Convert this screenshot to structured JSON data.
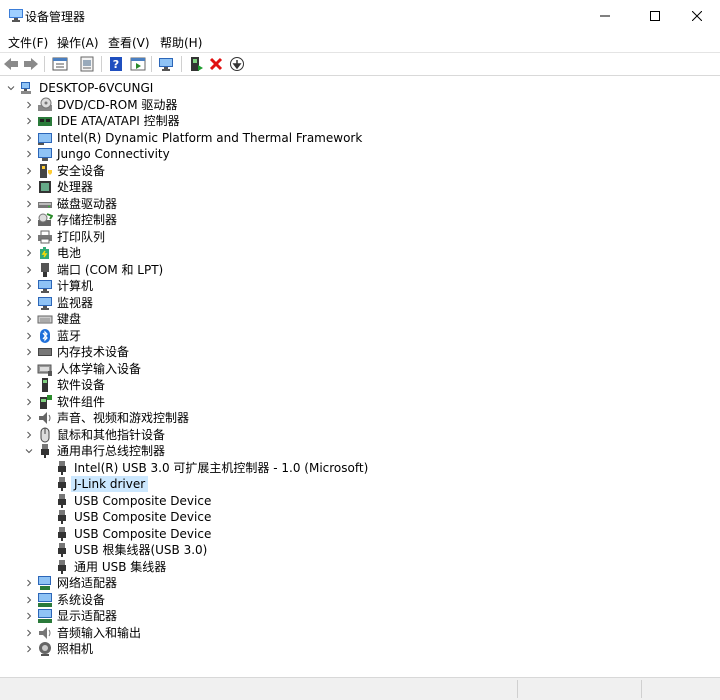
{
  "window": {
    "title": "设备管理器"
  },
  "menu": [
    "文件(F)",
    "操作(A)",
    "查看(V)",
    "帮助(H)"
  ],
  "toolbar": [
    "back-arrow-icon",
    "forward-arrow-icon",
    "properties-icon",
    "show-hidden-icon",
    "help-icon",
    "run-icon",
    "monitor-icon",
    "update-driver-icon",
    "uninstall-icon",
    "disable-icon"
  ],
  "tree": {
    "root": "DESKTOP-6VCUNGI",
    "categories": [
      {
        "label": "DVD/CD-ROM 驱动器",
        "icon": "dvd-drive-icon"
      },
      {
        "label": "IDE ATA/ATAPI 控制器",
        "icon": "ide-controller-icon"
      },
      {
        "label": "Intel(R) Dynamic Platform and Thermal Framework",
        "icon": "thermal-framework-icon"
      },
      {
        "label": "Jungo Connectivity",
        "icon": "jungo-icon"
      },
      {
        "label": "安全设备",
        "icon": "security-device-icon"
      },
      {
        "label": "处理器",
        "icon": "processor-icon"
      },
      {
        "label": "磁盘驱动器",
        "icon": "disk-drive-icon"
      },
      {
        "label": "存储控制器",
        "icon": "storage-controller-icon"
      },
      {
        "label": "打印队列",
        "icon": "printer-icon"
      },
      {
        "label": "电池",
        "icon": "battery-icon"
      },
      {
        "label": "端口 (COM 和 LPT)",
        "icon": "port-icon"
      },
      {
        "label": "计算机",
        "icon": "computer-icon"
      },
      {
        "label": "监视器",
        "icon": "monitor-icon"
      },
      {
        "label": "键盘",
        "icon": "keyboard-icon"
      },
      {
        "label": "蓝牙",
        "icon": "bluetooth-icon"
      },
      {
        "label": "内存技术设备",
        "icon": "memory-icon"
      },
      {
        "label": "人体学输入设备",
        "icon": "hid-icon"
      },
      {
        "label": "软件设备",
        "icon": "software-device-icon"
      },
      {
        "label": "软件组件",
        "icon": "software-component-icon"
      },
      {
        "label": "声音、视频和游戏控制器",
        "icon": "sound-icon"
      },
      {
        "label": "鼠标和其他指针设备",
        "icon": "mouse-icon"
      },
      {
        "label": "通用串行总线控制器",
        "icon": "usb-icon",
        "expanded": true
      },
      {
        "label": "网络适配器",
        "icon": "network-icon"
      },
      {
        "label": "系统设备",
        "icon": "system-device-icon"
      },
      {
        "label": "显示适配器",
        "icon": "display-adapter-icon"
      },
      {
        "label": "音频输入和输出",
        "icon": "audio-io-icon"
      },
      {
        "label": "照相机",
        "icon": "camera-icon"
      }
    ],
    "usb_children": [
      {
        "label": "Intel(R) USB 3.0 可扩展主机控制器 - 1.0 (Microsoft)"
      },
      {
        "label": "J-Link driver",
        "selected": true
      },
      {
        "label": "USB Composite Device"
      },
      {
        "label": "USB Composite Device"
      },
      {
        "label": "USB Composite Device"
      },
      {
        "label": "USB 根集线器(USB 3.0)"
      },
      {
        "label": "通用 USB 集线器"
      }
    ]
  }
}
